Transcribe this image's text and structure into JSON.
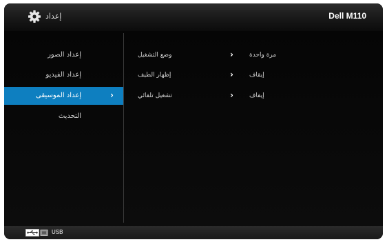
{
  "header": {
    "title": "إعداد",
    "model": "Dell M110",
    "icon": "gear-icon"
  },
  "sidebar": {
    "items": [
      {
        "label": "إعداد الصور"
      },
      {
        "label": "إعداد الفيديو"
      },
      {
        "label": "إعداد الموسيقى",
        "chevron": "›",
        "selected": true
      },
      {
        "label": "التحديث"
      }
    ]
  },
  "settings": [
    {
      "label": "وضع التشغيل",
      "chevron": "›",
      "value": "مرة واحدة"
    },
    {
      "label": "إظهار الطيف",
      "chevron": "›",
      "value": "إيقاف"
    },
    {
      "label": "تشغيل تلقائي",
      "chevron": "›",
      "value": "إيقاف"
    }
  ],
  "footer": {
    "source_label": "USB",
    "icon": "usb-icon"
  },
  "colors": {
    "accent": "#0e7fc0",
    "background": "#000000",
    "text": "#d4d4d4"
  }
}
